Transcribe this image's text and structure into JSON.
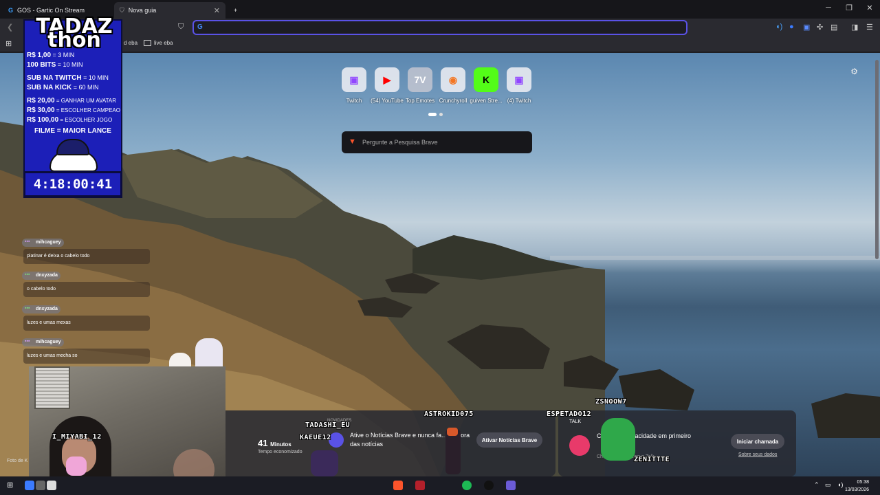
{
  "browser": {
    "tabs": [
      {
        "label": "GOS - Gartic On Stream",
        "active": false
      },
      {
        "label": "Nova guia",
        "active": true
      }
    ],
    "new_tab_symbol": "+",
    "window_controls": {
      "minimize": "─",
      "restore": "❐",
      "close": "✕"
    },
    "url_value": "",
    "bookmarks": [
      {
        "label": "d eba",
        "icon": "folder-icon"
      },
      {
        "label": "live eba",
        "icon": "folder-icon"
      }
    ]
  },
  "newtab": {
    "top_sites": [
      {
        "label": "Twitch",
        "icon": "twitch-icon",
        "color": "#9146ff",
        "glyph": "▣"
      },
      {
        "label": "(54) YouTube",
        "icon": "youtube-icon",
        "color": "#ff0000",
        "glyph": "▶"
      },
      {
        "label": "Top Emotes",
        "icon": "7tv-icon",
        "color": "#ffffff",
        "glyph": "7V"
      },
      {
        "label": "Crunchyroll",
        "icon": "crunchyroll-icon",
        "color": "#f47521",
        "glyph": "◉"
      },
      {
        "label": "guiven Stre...",
        "icon": "kick-icon",
        "color": "#53fc18",
        "glyph": "K"
      },
      {
        "label": "(4) Twitch",
        "icon": "twitch-icon",
        "color": "#9146ff",
        "glyph": "▣"
      }
    ],
    "search_placeholder": "Pergunte a Pesquisa Brave",
    "stats": {
      "value": "41",
      "unit": "Minutos",
      "caption": "Tempo economizado",
      "prev_caption": "zada"
    },
    "news_card": {
      "text": "Ative o Notícias Brave e nunca fa... por fora das notícias",
      "button": "Ativar Notícias Brave",
      "tag": "NOVIDADES"
    },
    "talk_card": {
      "tag": "TALK",
      "title": "Ch... com privacidade em primeiro",
      "subtitle": "Ch... das com o Brave Talk",
      "button": "Iniciar chamada",
      "link": "Sobre seus dados"
    },
    "photo_credit": "Foto de K"
  },
  "overlay": {
    "title_line1": "TADAZ",
    "title_line2": "thon",
    "rules": [
      {
        "key": "R$ 1,00",
        "value": "= 3 MIN"
      },
      {
        "key": "100 BITS",
        "value": "= 10 MIN"
      },
      {
        "key": "SUB NA TWITCH",
        "value": "= 10 MIN"
      },
      {
        "key": "SUB NA KICK",
        "value": "= 60 MIN"
      },
      {
        "key": "R$ 20,00",
        "value": "= GANHAR UM AVATAR"
      },
      {
        "key": "R$ 30,00",
        "value": "= ESCOLHER CAMPEAO"
      },
      {
        "key": "R$ 100,00",
        "value": "= ESCOLHER JOGO"
      },
      {
        "key": "FILME",
        "value": "= MAIOR LANCE"
      }
    ],
    "timer": "4:18:00:41"
  },
  "chat": [
    {
      "user": "mihcaguey",
      "message": "platinar é deixa o cabelo todo"
    },
    {
      "user": "dnxyzada",
      "message": "o cabelo todo"
    },
    {
      "user": "dnxyzada",
      "message": "luzes e umas mexas"
    },
    {
      "user": "mihcaguey",
      "message": "luzes e umas mecha so"
    }
  ],
  "stream_names": {
    "webcam": "I_MIYABI_12",
    "n1": "TADASHI_EU",
    "n2": "KAEUE12",
    "n3": "ASTROKID075",
    "n4": "ESPETADO12",
    "n5": "ZSNOOW7",
    "n6": "ZENITTTE"
  },
  "taskbar": {
    "time": "05:38",
    "date": "13/03/2026"
  },
  "colors": {
    "accent": "#5a52e6",
    "brave": "#fb542b",
    "panel": "#1c1fb8"
  }
}
